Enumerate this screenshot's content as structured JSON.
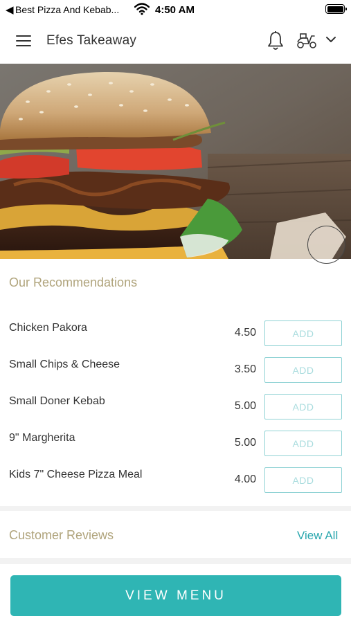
{
  "status_bar": {
    "back_glyph": "◀",
    "app_name": "Best Pizza And Kebab...",
    "time": "4:50 AM",
    "wifi_icon": "wifi-icon",
    "battery_icon": "battery-icon"
  },
  "header": {
    "title": "Efes Takeaway",
    "menu_icon": "hamburger-menu-icon",
    "notification_icon": "bell-icon",
    "delivery_icon": "scooter-icon",
    "dropdown_icon": "chevron-down-icon"
  },
  "hero": {
    "image_subject": "burger",
    "carousel_indicator": "circle"
  },
  "recommendations": {
    "title": "Our Recommendations",
    "add_label": "ADD",
    "items": [
      {
        "name": "Chicken Pakora",
        "price": "4.50"
      },
      {
        "name": "Small Chips & Cheese",
        "price": "3.50"
      },
      {
        "name": "Small Doner Kebab",
        "price": "5.00"
      },
      {
        "name": "9\" Margherita",
        "price": "5.00"
      },
      {
        "name": "Kids 7\" Cheese Pizza Meal",
        "price": "4.00"
      }
    ]
  },
  "reviews": {
    "title": "Customer Reviews",
    "view_all_label": "View All"
  },
  "footer": {
    "view_menu_label": "VIEW MENU"
  },
  "colors": {
    "accent": "#2fb5b4",
    "section_title": "#b0a47c",
    "link": "#2aa7ae",
    "add_border": "#8ed2d4"
  }
}
